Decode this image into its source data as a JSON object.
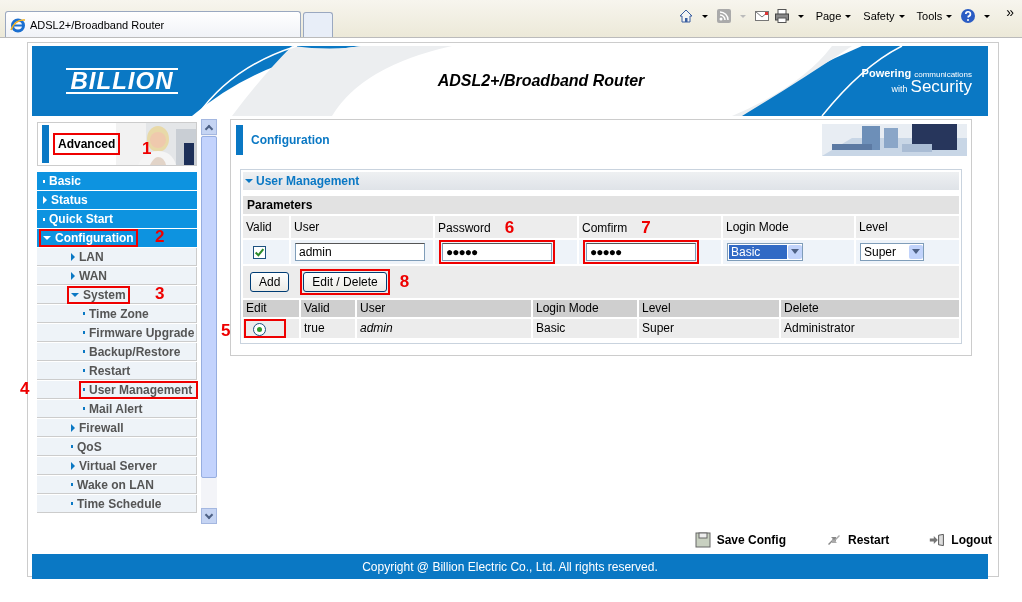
{
  "browser": {
    "tab_title": "ADSL2+/Broadband Router",
    "menus": [
      "Page",
      "Safety",
      "Tools"
    ],
    "overflow": "»"
  },
  "header": {
    "logo": "BILLION",
    "title": "ADSL2+/Broadband Router",
    "tagline_bold": "Powering",
    "tagline_small": "communications",
    "tagline_with": "with",
    "tagline_security": "Security"
  },
  "sidebar": {
    "mode_tab": {
      "label": "Advanced",
      "highlighted": true,
      "callout": "1"
    },
    "items": [
      {
        "label": "Basic",
        "kind": "link"
      },
      {
        "label": "Status",
        "kind": "folder",
        "expanded": false
      },
      {
        "label": "Quick Start",
        "kind": "link"
      },
      {
        "label": "Configuration",
        "kind": "folder",
        "expanded": true,
        "highlighted": true,
        "callout": "2",
        "children": [
          {
            "label": "LAN",
            "kind": "folder",
            "expanded": false
          },
          {
            "label": "WAN",
            "kind": "folder",
            "expanded": false
          },
          {
            "label": "System",
            "kind": "folder",
            "expanded": true,
            "highlighted": true,
            "callout": "3",
            "children": [
              {
                "label": "Time Zone",
                "kind": "link"
              },
              {
                "label": "Firmware Upgrade",
                "kind": "link"
              },
              {
                "label": "Backup/Restore",
                "kind": "link"
              },
              {
                "label": "Restart",
                "kind": "link"
              },
              {
                "label": "User Management",
                "kind": "link",
                "highlighted": true,
                "callout": "4"
              },
              {
                "label": "Mail Alert",
                "kind": "link"
              }
            ]
          },
          {
            "label": "Firewall",
            "kind": "folder",
            "expanded": false
          },
          {
            "label": "QoS",
            "kind": "link"
          },
          {
            "label": "Virtual Server",
            "kind": "folder",
            "expanded": false
          },
          {
            "label": "Wake on LAN",
            "kind": "link"
          },
          {
            "label": "Time Schedule",
            "kind": "link"
          }
        ]
      }
    ]
  },
  "panel": {
    "title": "Configuration",
    "section": {
      "title": "User Management",
      "expanded": true
    },
    "parameters_label": "Parameters",
    "columns": [
      {
        "label": "Valid"
      },
      {
        "label": "User"
      },
      {
        "label": "Password",
        "callout": "6"
      },
      {
        "label": "Comfirm",
        "callout": "7"
      },
      {
        "label": "Login Mode"
      },
      {
        "label": "Level"
      }
    ],
    "form": {
      "valid_checked": true,
      "user": "admin",
      "password": {
        "value": "●●●●●",
        "highlighted": true
      },
      "confirm": {
        "value": "●●●●●",
        "highlighted": true
      },
      "login_mode": {
        "value": "Basic",
        "focused": true
      },
      "level": {
        "value": "Super",
        "focused": false
      }
    },
    "buttons": [
      {
        "label": "Add"
      },
      {
        "label": "Edit / Delete",
        "highlighted": true,
        "callout": "8"
      }
    ],
    "list_columns": [
      "Edit",
      "Valid",
      "User",
      "Login Mode",
      "Level",
      "Delete"
    ],
    "rows": [
      {
        "selected": true,
        "highlighted": true,
        "callout": "5",
        "valid": "true",
        "user": "admin",
        "login_mode": "Basic",
        "level": "Super",
        "delete": "Administrator"
      }
    ]
  },
  "footer": {
    "actions": [
      "Save Config",
      "Restart",
      "Logout"
    ],
    "copyright": "Copyright @ Billion Electric Co., Ltd. All rights reserved."
  }
}
